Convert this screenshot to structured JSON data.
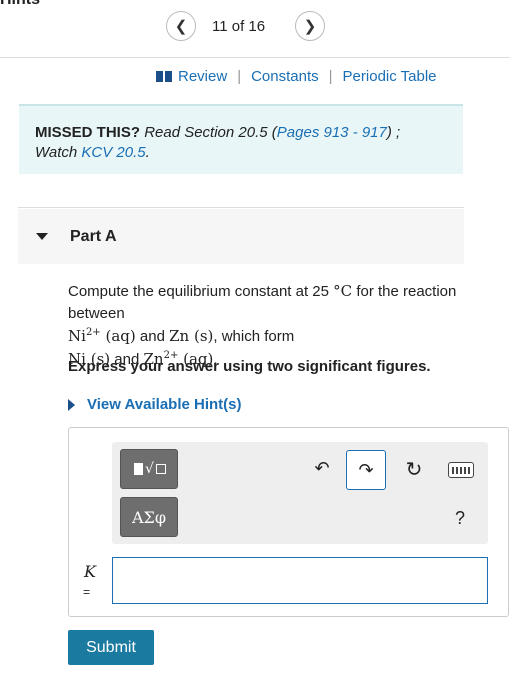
{
  "header": {
    "cut_title": "Hints"
  },
  "pager": {
    "prev_icon": "chevron-left-icon",
    "next_icon": "chevron-right-icon",
    "count_text": "11 of 16"
  },
  "links": {
    "review": "Review",
    "constants": "Constants",
    "periodic_table": "Periodic Table",
    "separator": "|"
  },
  "missed": {
    "label": "MISSED THIS?",
    "read": "Read Section 20.5 (",
    "pages_link": "Pages 913 - 917",
    "after_pages": ") ;",
    "watch": "Watch",
    "kcv_link": "KCV 20.5",
    "period": "."
  },
  "part": {
    "title": "Part A"
  },
  "question": {
    "t1": "Compute the equilibrium constant at 25",
    "deg": "°C",
    "t2": "for the reaction between",
    "ni_ion": "Ni",
    "ni_charge": "2+",
    "aq1": "(aq)",
    "and1": "and",
    "zn": "Zn",
    "s1": "(s)",
    "t3": ", which form",
    "ni": "Ni",
    "s2": "(s)",
    "and2": "and",
    "zn_ion": "Zn",
    "zn_charge": "2+",
    "aq2": "(aq)",
    "end": "."
  },
  "instruction": "Express your answer using two significant figures.",
  "hint_link": "View Available Hint(s)",
  "toolbar": {
    "greek_label": "ΑΣφ",
    "undo_glyph": "↶",
    "redo_glyph": "↷",
    "reset_glyph": "↻",
    "help_label": "?"
  },
  "answer": {
    "var_label": "K",
    "eq_label": "=",
    "value": ""
  },
  "submit_label": "Submit",
  "colors": {
    "accent": "#1a6fb4",
    "submit": "#1b7aa0",
    "panel": "#e9f6f7"
  }
}
